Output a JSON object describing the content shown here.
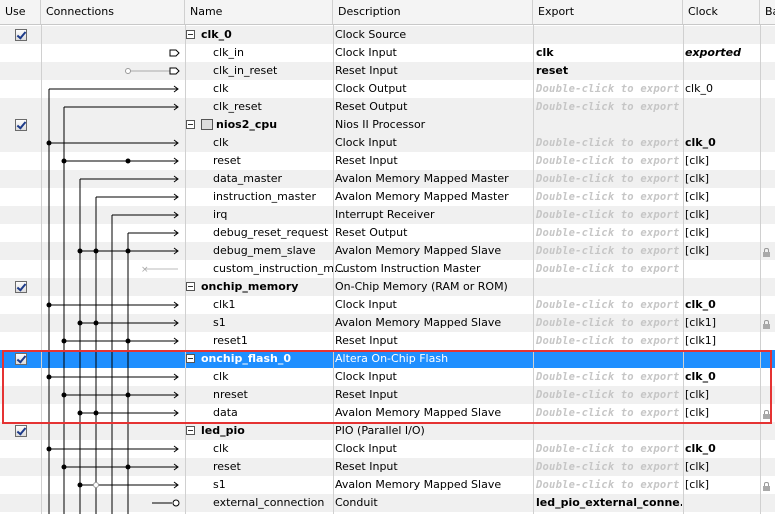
{
  "columns": {
    "use": "Use",
    "connections": "Connections",
    "name": "Name",
    "description": "Description",
    "export": "Export",
    "clock": "Clock",
    "base": "Ba"
  },
  "rows": [
    {
      "kind": "parent",
      "checked": true,
      "name": "clk_0",
      "description": "Clock Source",
      "export": "",
      "clock": ""
    },
    {
      "kind": "child",
      "name": "clk_in",
      "description": "Clock Input",
      "export": "clk",
      "export_style": "bold",
      "clock": "exported",
      "clock_style": "italbold"
    },
    {
      "kind": "child",
      "name": "clk_in_reset",
      "description": "Reset Input",
      "export": "reset",
      "export_style": "bold",
      "clock": ""
    },
    {
      "kind": "child",
      "name": "clk",
      "description": "Clock Output",
      "export": "Double-click to export",
      "export_style": "ph",
      "clock": "clk_0"
    },
    {
      "kind": "child",
      "name": "clk_reset",
      "description": "Reset Output",
      "export": "Double-click to export",
      "export_style": "ph",
      "clock": ""
    },
    {
      "kind": "parent",
      "checked": true,
      "icon": "processor-icon",
      "name": "nios2_cpu",
      "description": "Nios II Processor",
      "export": "",
      "clock": ""
    },
    {
      "kind": "child",
      "name": "clk",
      "description": "Clock Input",
      "export": "Double-click to export",
      "export_style": "ph",
      "clock": "clk_0",
      "clock_style": "clkbold"
    },
    {
      "kind": "child",
      "name": "reset",
      "description": "Reset Input",
      "export": "Double-click to export",
      "export_style": "ph",
      "clock": "[clk]"
    },
    {
      "kind": "child",
      "name": "data_master",
      "description": "Avalon Memory Mapped Master",
      "export": "Double-click to export",
      "export_style": "ph",
      "clock": "[clk]"
    },
    {
      "kind": "child",
      "name": "instruction_master",
      "description": "Avalon Memory Mapped Master",
      "export": "Double-click to export",
      "export_style": "ph",
      "clock": "[clk]"
    },
    {
      "kind": "child",
      "name": "irq",
      "description": "Interrupt Receiver",
      "export": "Double-click to export",
      "export_style": "ph",
      "clock": "[clk]"
    },
    {
      "kind": "child",
      "name": "debug_reset_request",
      "description": "Reset Output",
      "export": "Double-click to export",
      "export_style": "ph",
      "clock": "[clk]"
    },
    {
      "kind": "child",
      "name": "debug_mem_slave",
      "description": "Avalon Memory Mapped Slave",
      "export": "Double-click to export",
      "export_style": "ph",
      "clock": "[clk]",
      "lock": true
    },
    {
      "kind": "child",
      "name": "custom_instruction_m...",
      "description": "Custom Instruction Master",
      "export": "Double-click to export",
      "export_style": "ph",
      "clock": ""
    },
    {
      "kind": "parent",
      "checked": true,
      "name": "onchip_memory",
      "description": "On-Chip Memory (RAM or ROM)",
      "export": "",
      "clock": ""
    },
    {
      "kind": "child",
      "name": "clk1",
      "description": "Clock Input",
      "export": "Double-click to export",
      "export_style": "ph",
      "clock": "clk_0",
      "clock_style": "clkbold"
    },
    {
      "kind": "child",
      "name": "s1",
      "description": "Avalon Memory Mapped Slave",
      "export": "Double-click to export",
      "export_style": "ph",
      "clock": "[clk1]",
      "lock": true
    },
    {
      "kind": "child",
      "name": "reset1",
      "description": "Reset Input",
      "export": "Double-click to export",
      "export_style": "ph",
      "clock": "[clk1]"
    },
    {
      "kind": "parent",
      "checked": true,
      "selected": true,
      "name": "onchip_flash_0",
      "description": "Altera On-Chip Flash",
      "export": "",
      "clock": ""
    },
    {
      "kind": "child",
      "name": "clk",
      "description": "Clock Input",
      "export": "Double-click to export",
      "export_style": "ph",
      "clock": "clk_0",
      "clock_style": "clkbold"
    },
    {
      "kind": "child",
      "name": "nreset",
      "description": "Reset Input",
      "export": "Double-click to export",
      "export_style": "ph",
      "clock": "[clk]"
    },
    {
      "kind": "child",
      "name": "data",
      "description": "Avalon Memory Mapped Slave",
      "export": "Double-click to export",
      "export_style": "ph",
      "clock": "[clk]",
      "lock": true
    },
    {
      "kind": "parent",
      "checked": true,
      "name": "led_pio",
      "description": "PIO (Parallel I/O)",
      "export": "",
      "clock": ""
    },
    {
      "kind": "child",
      "name": "clk",
      "description": "Clock Input",
      "export": "Double-click to export",
      "export_style": "ph",
      "clock": "clk_0",
      "clock_style": "clkbold"
    },
    {
      "kind": "child",
      "name": "reset",
      "description": "Reset Input",
      "export": "Double-click to export",
      "export_style": "ph",
      "clock": "[clk]"
    },
    {
      "kind": "child",
      "name": "s1",
      "description": "Avalon Memory Mapped Slave",
      "export": "Double-click to export",
      "export_style": "ph",
      "clock": "[clk]",
      "lock": true
    },
    {
      "kind": "child",
      "name": "external_connection",
      "description": "Conduit",
      "export": "led_pio_external_conne...",
      "export_style": "bold",
      "clock": ""
    }
  ],
  "colors": {
    "selection": "#1f8fff",
    "highlight_border": "#e53333",
    "placeholder_text": "#c6c6c6"
  }
}
